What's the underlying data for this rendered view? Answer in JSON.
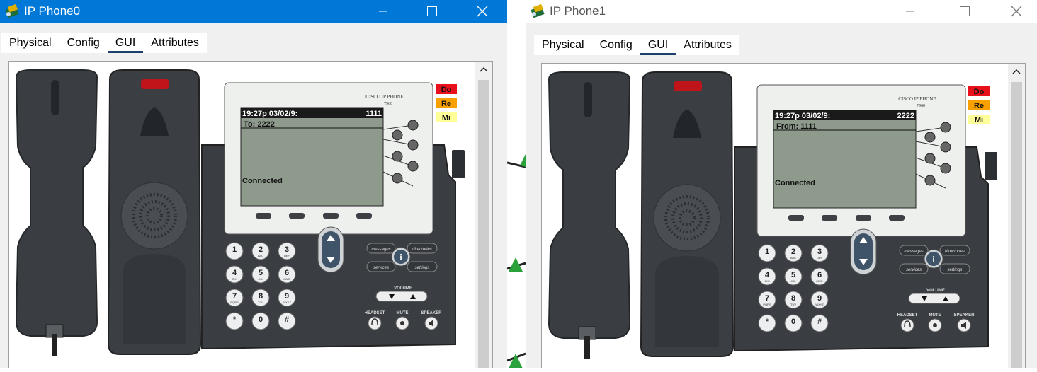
{
  "windows": [
    {
      "title": "IP Phone0",
      "tabs": [
        "Physical",
        "Config",
        "GUI",
        "Attributes"
      ],
      "active_tab": "GUI",
      "phone": {
        "brand": "CISCO IP PHONE",
        "model": "7960",
        "screen": {
          "time": "19:27p 03/02/9:",
          "line": "1111",
          "call_party": "To: 2222",
          "status": "Connected"
        },
        "line_indicators": [
          "Do",
          "Re",
          "Mi"
        ],
        "keys": [
          "1",
          "2",
          "3",
          "4",
          "5",
          "6",
          "7",
          "8",
          "9",
          "*",
          "0",
          "#"
        ],
        "key_subs": [
          "",
          "ABC",
          "DEF",
          "GHI",
          "JKL",
          "MNO",
          "PQRS",
          "TUV",
          "WXYZ",
          "",
          "",
          ""
        ],
        "func_labels": {
          "messages": "messages",
          "directories": "directories",
          "services": "services",
          "settings": "settings",
          "info": "i",
          "volume": "VOLUME",
          "headset": "HEADSET",
          "mute": "MUTE",
          "speaker": "SPEAKER"
        }
      }
    },
    {
      "title": "IP Phone1",
      "tabs": [
        "Physical",
        "Config",
        "GUI",
        "Attributes"
      ],
      "active_tab": "GUI",
      "phone": {
        "brand": "CISCO IP PHONE",
        "model": "7960",
        "screen": {
          "time": "19:27p 03/02/9:",
          "line": "2222",
          "call_party": "From: 1111",
          "status": "Connected"
        },
        "line_indicators": [
          "Do",
          "Re",
          "Mi"
        ],
        "keys": [
          "1",
          "2",
          "3",
          "4",
          "5",
          "6",
          "7",
          "8",
          "9",
          "*",
          "0",
          "#"
        ],
        "key_subs": [
          "",
          "ABC",
          "DEF",
          "GHI",
          "JKL",
          "MNO",
          "PQRS",
          "TUV",
          "WXYZ",
          "",
          "",
          ""
        ],
        "func_labels": {
          "messages": "messages",
          "directories": "directories",
          "services": "services",
          "settings": "settings",
          "info": "i",
          "volume": "VOLUME",
          "headset": "HEADSET",
          "mute": "MUTE",
          "speaker": "SPEAKER"
        }
      }
    }
  ],
  "colors": {
    "titlebar_active": "#0078d7",
    "titlebar_inactive": "#ffffff",
    "indicator_red": "#e8101a",
    "indicator_orange": "#f7a000",
    "indicator_yellow": "#ffff99",
    "lcd": "#8e9a8c",
    "phone_body": "#3a3f44"
  }
}
